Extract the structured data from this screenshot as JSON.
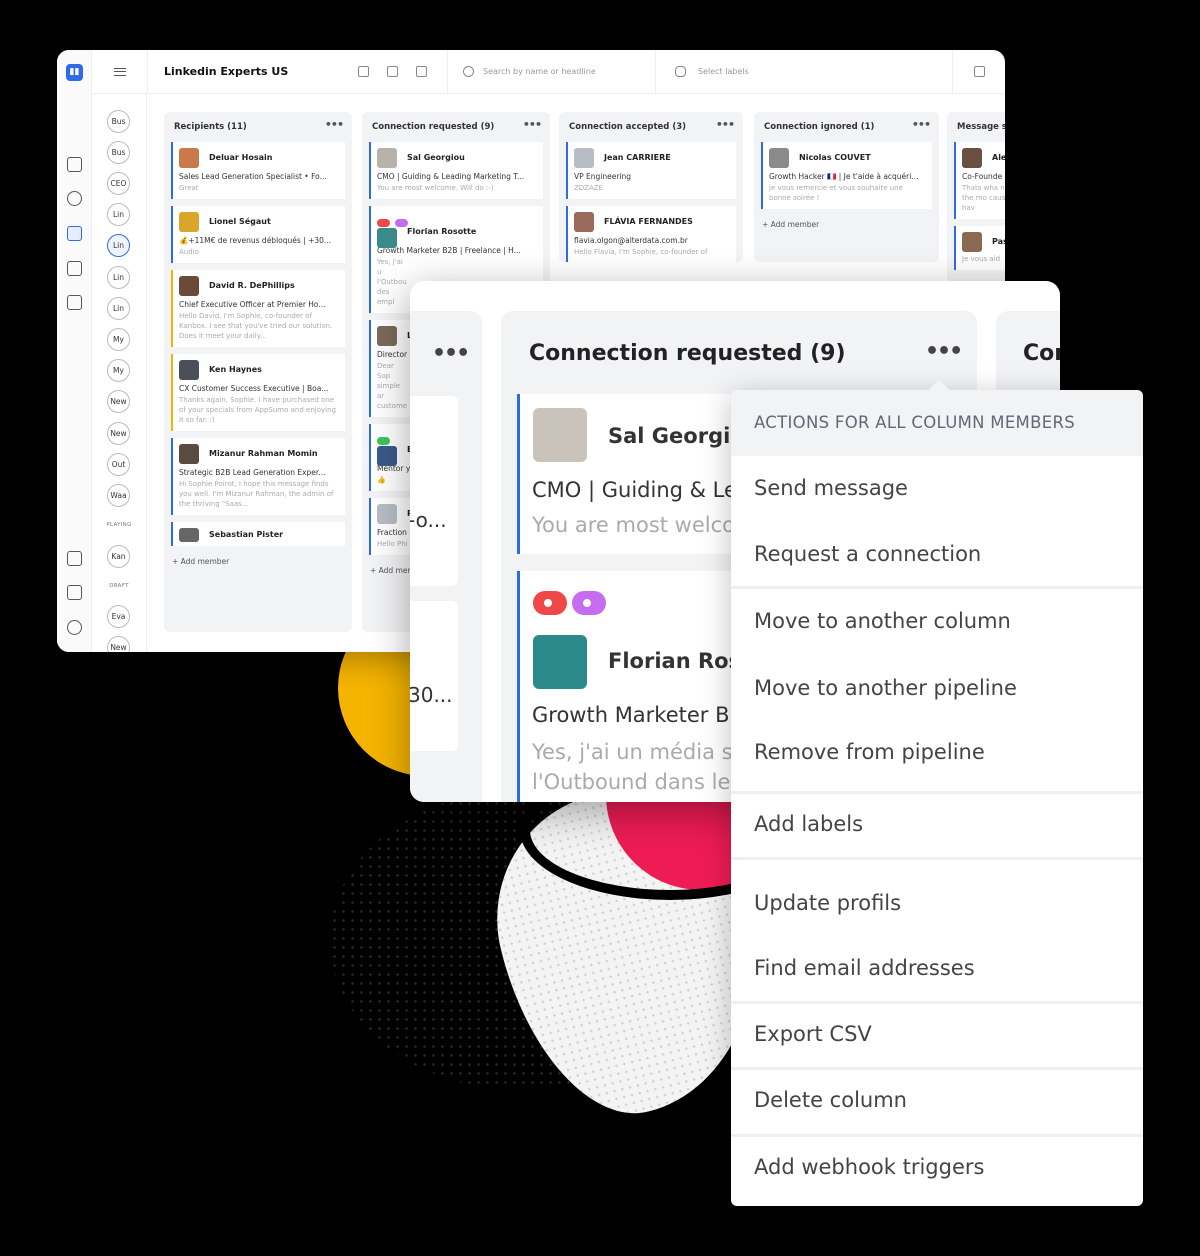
{
  "app": {
    "title": "Linkedin Experts US",
    "search_placeholder": "Search by name or headline",
    "labels_placeholder": "Select labels"
  },
  "pills": [
    "Bus",
    "Bus",
    "CEO",
    "Lin",
    "Lin",
    "Lin",
    "Lin",
    "My",
    "My",
    "New",
    "New",
    "Out",
    "Waa",
    "Kan",
    "Eva",
    "New"
  ],
  "pill_groups": {
    "playing": "PLAYING",
    "draft": "DRAFT"
  },
  "columns": [
    {
      "title": "Recipients (11)",
      "add": "+ Add member",
      "cards": [
        {
          "name": "Deluar Hosain",
          "headline": "Sales Lead Generation Specialist • Fo...",
          "message": "Great"
        },
        {
          "name": "Lionel Ségaut",
          "headline": "💰+11M€ de revenus débloqués | +30...",
          "message": "Audio"
        },
        {
          "name": "David R. DePhillips",
          "headline": "Chief Executive Officer at Premier Ho...",
          "message": "Hello David, I'm Sophie, co-founder of Kanbox. I see that you've tried our solution. Does it meet your daily..."
        },
        {
          "name": "Ken Haynes",
          "headline": "CX Customer Success Executive | Boa...",
          "message": "Thanks again, Sophie. I have purchased one of your specials from AppSumo and enjoying it so far. :)"
        },
        {
          "name": "Mizanur Rahman Momin",
          "headline": "Strategic B2B Lead Generation Exper...",
          "message": "Hi Sophie Poirot, I hope this message finds you well. I'm Mizanur Rahman, the admin of the thriving \"Saas..."
        },
        {
          "name": "Sebastian Pister",
          "headline": "",
          "message": ""
        }
      ]
    },
    {
      "title": "Connection requested (9)",
      "add": "+ Add member",
      "cards": [
        {
          "name": "Sal Georgiou",
          "headline": "CMO | Guiding & Leading Marketing T...",
          "message": "You are most welcome. Will do :-)"
        },
        {
          "name": "Florian Rosotte",
          "headline": "Growth Marketer B2B | Freelance | H...",
          "message": "Yes, j'ai u l'Outbou des empl"
        },
        {
          "name": "L",
          "headline": "Director",
          "message": "Dear Sop simple ar custome"
        },
        {
          "name": "E",
          "headline": "Mentor y",
          "message": "👍"
        },
        {
          "name": "P",
          "headline": "Fraction",
          "message": "Hello Phi"
        }
      ]
    },
    {
      "title": "Connection accepted (3)",
      "add": "",
      "cards": [
        {
          "name": "Jean CARRIERE",
          "headline": "VP Engineering",
          "message": "ZDZAZE"
        },
        {
          "name": "FLÁVIA FERNANDES",
          "headline": "flavia.olgon@alterdata.com.br",
          "message": "Hello Flavia, I'm Sophie, co-founder of"
        }
      ]
    },
    {
      "title": "Connection ignored (1)",
      "add": "+ Add member",
      "cards": [
        {
          "name": "Nicolas COUVET",
          "headline": "Growth Hacker 🇫🇷 | Je t'aide à acquéri...",
          "message": "je vous remercie et vous souhaite une bonne soirée !"
        }
      ]
    },
    {
      "title": "Message s",
      "add": "",
      "cards": [
        {
          "name": "Ale",
          "headline": "Co-Founde",
          "message": "Thats wha not the mo cause I hav"
        },
        {
          "name": "Pas",
          "headline": "",
          "message": "Je vous aid"
        }
      ]
    }
  ],
  "zoom": {
    "column_title": "Connection requested (9)",
    "next_column_partial": "Cor",
    "left_partial_1": "-o...",
    "left_partial_2": "30...",
    "card1": {
      "name": "Sal Georgio",
      "headline": "CMO | Guiding & Le",
      "message": "You are most welco"
    },
    "card2": {
      "name": "Florian Ros",
      "headline": "Growth Marketer B",
      "message_1": "Yes, j'ai un média sp",
      "message_2": "l'Outbound dans le"
    },
    "tag_colors": [
      "#f04848",
      "#c66cf0"
    ]
  },
  "dropdown": {
    "header": "ACTIONS FOR ALL COLUMN MEMBERS",
    "items": [
      "Send message",
      "Request a connection",
      "Move to another column",
      "Move to another pipeline",
      "Remove from pipeline",
      "Add labels",
      "Update profils",
      "Find email addresses",
      "Export CSV",
      "Delete column",
      "Add webhook triggers"
    ]
  },
  "colors": {
    "accent": "#2f6be5",
    "yellow_blob": "#f5b400",
    "red_blob": "#ee1c54"
  }
}
